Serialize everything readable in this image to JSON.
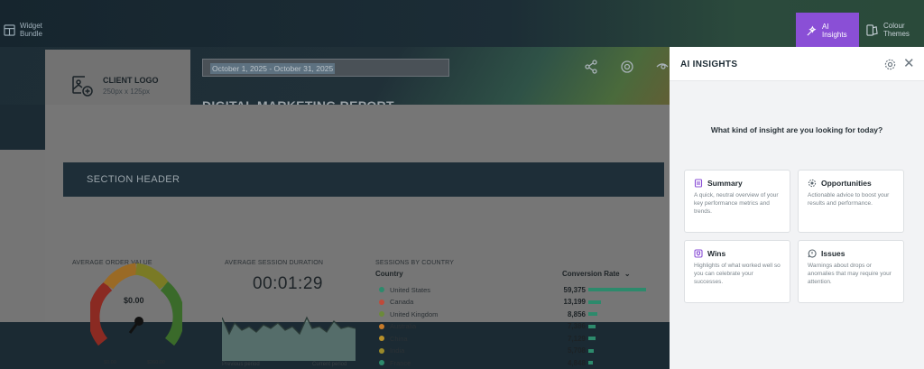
{
  "topbar": {
    "widget_bundle": "Widget Bundle",
    "ai_insights": "AI Insights",
    "colour_themes": "Colour Themes"
  },
  "report": {
    "logo_title": "CLIENT LOGO",
    "logo_size": "250px x 125px",
    "date_range": "October 1, 2025 - October 31, 2025",
    "title": "DIGITAL MARKETING REPORT",
    "section_header": "SECTION HEADER",
    "widgets": {
      "aov_label": "AVERAGE ORDER VALUE",
      "aov_value": "$0.00",
      "aov_min": "$0.00",
      "aov_max": "$260.00",
      "duration_label": "AVERAGE SESSION DURATION",
      "duration_value": "00:01:29",
      "duration_left": "Previous period",
      "duration_right": "Current period",
      "sessions_label": "SESSIONS BY COUNTRY",
      "col_country": "Country",
      "col_conversion": "Conversion Rate",
      "countries": [
        {
          "name": "United States",
          "value": "59,375",
          "amount": 59375,
          "color": "#2d8a6c"
        },
        {
          "name": "Canada",
          "value": "13,199",
          "amount": 13199,
          "color": "#c04a3a"
        },
        {
          "name": "United Kingdom",
          "value": "8,856",
          "amount": 8856,
          "color": "#6b8a3a"
        },
        {
          "name": "Australia",
          "value": "7,386",
          "amount": 7386,
          "color": "#c67a2a"
        },
        {
          "name": "China",
          "value": "7,129",
          "amount": 7129,
          "color": "#b8902a"
        },
        {
          "name": "India",
          "value": "5,708",
          "amount": 5708,
          "color": "#9a8a2a"
        },
        {
          "name": "France",
          "value": "4,848",
          "amount": 4848,
          "color": "#2d8a6c"
        }
      ]
    }
  },
  "ai_panel": {
    "title": "AI INSIGHTS",
    "question": "What kind of insight are you looking for today?",
    "cards": [
      {
        "title": "Summary",
        "desc": "A quick, neutral overview of your key performance metrics and trends.",
        "color": "#8a4fd6"
      },
      {
        "title": "Opportunities",
        "desc": "Actionable advice to boost your results and performance.",
        "color": "#5b6770"
      },
      {
        "title": "Wins",
        "desc": "Highlights of what worked well so you can celebrate your successes.",
        "color": "#8a4fd6"
      },
      {
        "title": "Issues",
        "desc": "Warnings about drops or anomalies that may require your attention.",
        "color": "#5b6770"
      }
    ]
  }
}
